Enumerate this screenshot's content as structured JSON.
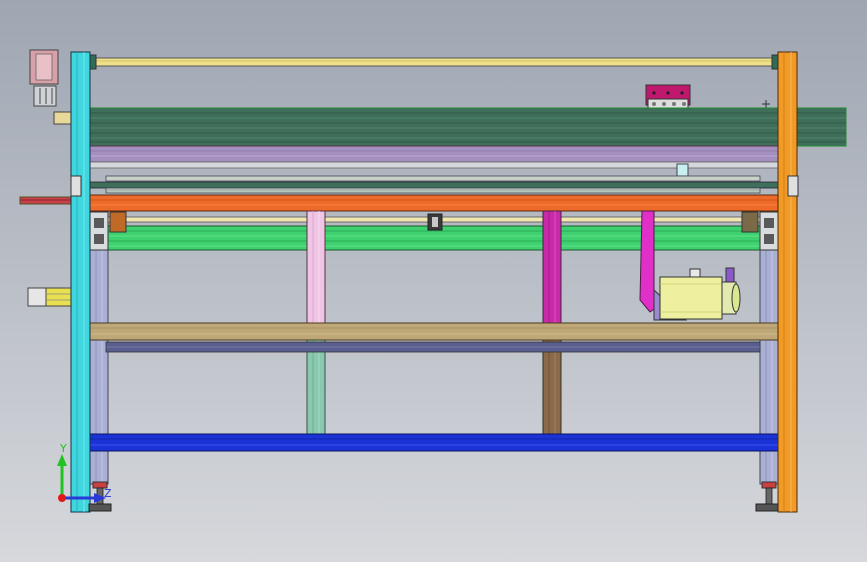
{
  "viewport": {
    "background_top": "#9fa6b2",
    "background_bottom": "#d6d8dc"
  },
  "triad": {
    "y_label": "Y",
    "z_label": "Z",
    "y_color": "#22c222",
    "z_color": "#2a3ad8",
    "origin_color": "#e01818"
  },
  "colors": {
    "left_post": "#3fd6e0",
    "right_post": "#f29a26",
    "top_rod": "#f0e08a",
    "green_beam": "#3f6f5a",
    "purple_beam": "#a48fc0",
    "orange_beam": "#ee6a28",
    "bright_green_beam": "#3fd070",
    "tan_beam": "#bfa878",
    "blue_beam": "#1b33d6",
    "motor_body": "#eef0a0",
    "magenta_arm": "#e030c8",
    "magenta_block": "#c0186c"
  }
}
